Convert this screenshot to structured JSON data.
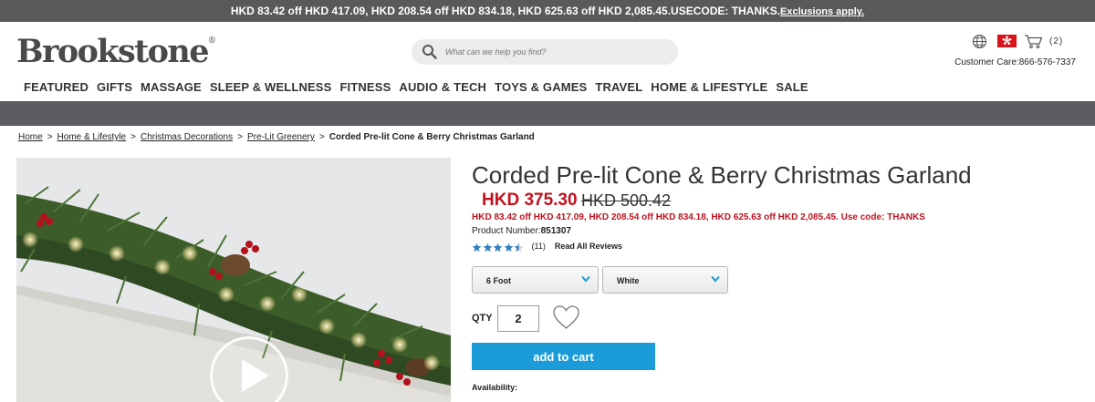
{
  "promo": {
    "text": "HKD 83.42 off HKD 417.09, HKD 208.54 off HKD 834.18, HKD 625.63 off HKD 2,085.45.USECODE: THANKS.",
    "exclusions": "Exclusions apply."
  },
  "header": {
    "logo": "Brookstone",
    "logo_mark": "®",
    "search_placeholder": "What can we help you find?",
    "cart_count": "(2)",
    "customer_care": "Customer Care:866-576-7337"
  },
  "nav": [
    "FEATURED",
    "GIFTS",
    "MASSAGE",
    "SLEEP & WELLNESS",
    "FITNESS",
    "AUDIO & TECH",
    "TOYS & GAMES",
    "TRAVEL",
    "HOME & LIFESTYLE",
    "SALE"
  ],
  "breadcrumb": {
    "items": [
      "Home",
      "Home & Lifestyle",
      "Christmas Decorations",
      "Pre-Lit Greenery"
    ],
    "current": "Corded Pre-lit Cone & Berry Christmas Garland",
    "separator": ">"
  },
  "product": {
    "title": "Corded Pre-lit Cone & Berry Christmas Garland",
    "price": "HKD 375.30",
    "old_price": " HKD 500.42",
    "promo": "HKD 83.42 off HKD 417.09, HKD 208.54 off HKD 834.18, HKD 625.63 off HKD 2,085.45. Use code: THANKS",
    "number_label": "Product Number:",
    "number": "851307",
    "rating": 4.5,
    "review_count": "(11)",
    "reviews_link": "Read All Reviews",
    "size_select": "6 Foot",
    "color_select": "White",
    "qty_label": "QTY",
    "qty": "2",
    "add_to_cart": "add to cart",
    "availability": "Availability:"
  },
  "colors": {
    "promo_bar": "#58595b",
    "price_red": "#c1121f",
    "cart_button": "#1b9bd8",
    "star_blue": "#2f7fc1",
    "select_chevron": "#1b9bd8"
  }
}
